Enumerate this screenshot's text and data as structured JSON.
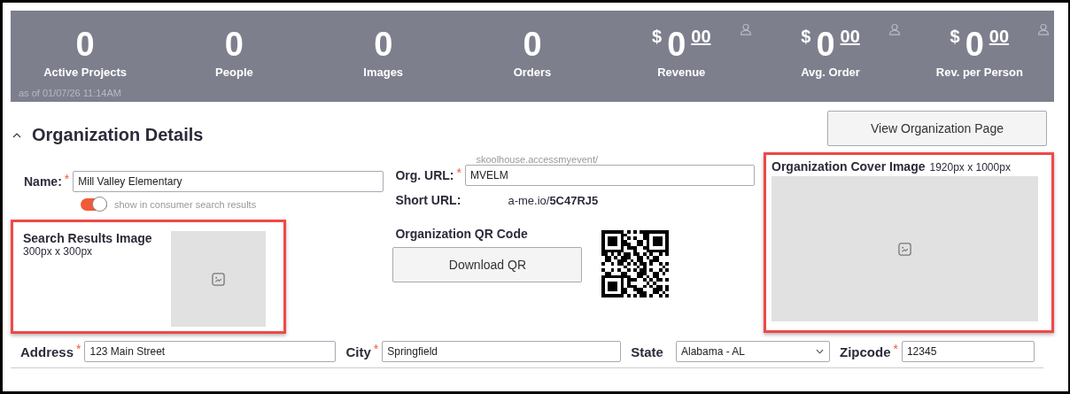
{
  "stats": [
    {
      "kind": "count",
      "value": "0",
      "label": "Active Projects"
    },
    {
      "kind": "count",
      "value": "0",
      "label": "People"
    },
    {
      "kind": "count",
      "value": "0",
      "label": "Images"
    },
    {
      "kind": "count",
      "value": "0",
      "label": "Orders"
    },
    {
      "kind": "money",
      "currency": "$",
      "value": "0",
      "cents": "00",
      "label": "Revenue"
    },
    {
      "kind": "money",
      "currency": "$",
      "value": "0",
      "cents": "00",
      "label": "Avg. Order"
    },
    {
      "kind": "money",
      "currency": "$",
      "value": "0",
      "cents": "00",
      "label": "Rev. per Person"
    }
  ],
  "as_of": "as of 01/07/26 11:14AM",
  "section": {
    "title": "Organization Details",
    "expanded": true
  },
  "view_button": "View Organization Page",
  "name": {
    "label": "Name:",
    "required_mark": "*",
    "value": "Mill Valley Elementary"
  },
  "visibility_toggle": {
    "label": "show in consumer search results",
    "on": true
  },
  "search_image": {
    "title": "Search Results Image",
    "size": "300px x 300px",
    "highlighted": true
  },
  "org_url": {
    "prefix": "skoolhouse.accessmyevent/",
    "label": "Org. URL:",
    "required_mark": "*",
    "value": "MVELM"
  },
  "short_url": {
    "label": "Short URL:",
    "value": "a-me.io/**5C47RJ5**"
  },
  "qr": {
    "title": "Organization QR Code",
    "button": "Download QR"
  },
  "cover_image": {
    "title": "Organization Cover Image",
    "size": "1920px x 1000px",
    "highlighted": true
  },
  "address_fields": [
    {
      "kind": "text",
      "label": "Address",
      "required_mark": "*",
      "value": "123 Main Street"
    },
    {
      "kind": "text",
      "label": "City",
      "required_mark": "*",
      "value": "Springfield"
    },
    {
      "kind": "select",
      "label": "State",
      "value": "Alabama - AL"
    },
    {
      "kind": "text",
      "label": "Zipcode",
      "required_mark": "*",
      "value": "12345"
    }
  ]
}
